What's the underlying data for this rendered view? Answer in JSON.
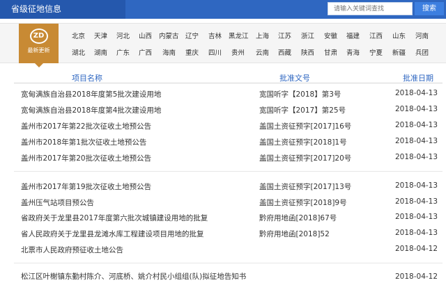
{
  "header": {
    "title": "省级征地信息",
    "search_placeholder": "请输入关键词查找",
    "search_button": "搜索"
  },
  "badge": {
    "logo": "ZD",
    "label": "最新更新"
  },
  "provinces_row1": [
    "北京",
    "天津",
    "河北",
    "山西",
    "内蒙古",
    "辽宁",
    "吉林",
    "黑龙江",
    "上海",
    "江苏",
    "浙江",
    "安徽",
    "福建",
    "江西",
    "山东",
    "河南"
  ],
  "provinces_row2": [
    "湖北",
    "湖南",
    "广东",
    "广西",
    "海南",
    "重庆",
    "四川",
    "贵州",
    "云南",
    "西藏",
    "陕西",
    "甘肃",
    "青海",
    "宁夏",
    "新疆",
    "兵团"
  ],
  "table": {
    "col_name": "项目名称",
    "col_doc": "批准文号",
    "col_date": "批准日期",
    "rows": [
      {
        "name": "宽甸满族自治县2018年度第5批次建设用地",
        "doc": "宽国听字【2018】第3号",
        "date": "2018-04-13"
      },
      {
        "name": "宽甸满族自治县2018年度第4批次建设用地",
        "doc": "宽国听字【2017】第25号",
        "date": "2018-04-13"
      },
      {
        "name": "盖州市2017年第22批次征收土地预公告",
        "doc": "盖国土资征预字[2017]16号",
        "date": "2018-04-13"
      },
      {
        "name": "盖州市2018年第1批次征收土地预公告",
        "doc": "盖国土资征预字[2018]1号",
        "date": "2018-04-13"
      },
      {
        "name": "盖州市2017年第20批次征收土地预公告",
        "doc": "盖国土资征预字[2017]20号",
        "date": "2018-04-13"
      },
      {
        "name": "盖州市2017年第19批次征收土地预公告",
        "doc": "盖国土资征预字[2017]13号",
        "date": "2018-04-13"
      },
      {
        "name": "盖州压气站项目预公告",
        "doc": "盖国土资征预字[2018]9号",
        "date": "2018-04-13"
      },
      {
        "name": "省政府关于龙里县2017年度第六批次城镇建设用地的批复",
        "doc": "黔府用地函[2018]67号",
        "date": "2018-04-13"
      },
      {
        "name": "省人民政府关于龙里县龙滩水库工程建设项目用地的批复",
        "doc": "黔府用地函[2018]52",
        "date": "2018-04-13"
      },
      {
        "name": "北票市人民政府预征收土地公告",
        "doc": "",
        "date": "2018-04-12"
      },
      {
        "name": "松江区叶榭镇东勤村陈介、河底桥、姚介村民小组组(队)拟征地告知书",
        "doc": "",
        "date": "2018-04-12"
      }
    ]
  }
}
